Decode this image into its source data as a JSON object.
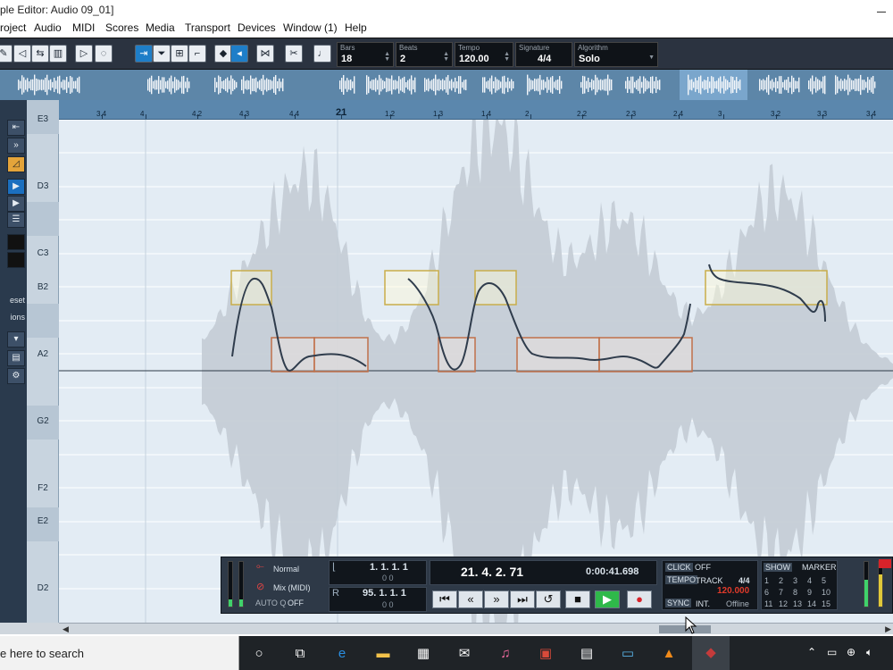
{
  "window": {
    "title": "ple Editor: Audio 09_01]"
  },
  "menu": [
    "roject",
    "Audio",
    "MIDI",
    "Scores",
    "Media",
    "Transport",
    "Devices",
    "Window (1)",
    "Help"
  ],
  "toolbar": {
    "bars_label": "Bars",
    "bars_value": "18",
    "beats_label": "Beats",
    "beats_value": "2",
    "tempo_label": "Tempo",
    "tempo_value": "120.00",
    "signature_label": "Signature",
    "signature_value": "4/4",
    "algorithm_label": "Algorithm",
    "algorithm_value": "Solo"
  },
  "ruler": {
    "ticks": [
      "3.4",
      "4",
      "4.2",
      "4.3",
      "4.4",
      "21",
      "1.2",
      "1.3",
      "1.4",
      "2",
      "2.2",
      "2.3",
      "2.4",
      "3",
      "3.2",
      "3.3",
      "3.4"
    ]
  },
  "pitch_labels": [
    "E3",
    "D3",
    "C3",
    "B2",
    "A2",
    "G2",
    "F2",
    "E2",
    "D2"
  ],
  "left_panel": {
    "preset_label": "eset",
    "options_label": "ions"
  },
  "transport": {
    "mode": "Normal",
    "mix_mode": "Mix (MIDI)",
    "autoq_label": "AUTO Q",
    "autoq_value": "OFF",
    "left_locator": "1. 1. 1.    1",
    "left_sub": "0     0",
    "right_locator": "95. 1. 1.    1",
    "right_sub": "0     0",
    "position_bars": "21. 4. 2. 71",
    "position_time": "0:00:41.698",
    "click_label": "CLICK",
    "click_value": "OFF",
    "tempo_label": "TEMPO",
    "track_label": "TRACK",
    "signature": "4/4",
    "tempo_value": "120.000",
    "sync_label": "SYNC",
    "int_label": "INT.",
    "offline_label": "Offline",
    "show_label": "SHOW",
    "marker_label": "MARKER",
    "markers": [
      "1",
      "2",
      "3",
      "4",
      "5",
      "6",
      "7",
      "8",
      "9",
      "10",
      "11",
      "12",
      "13",
      "14",
      "15"
    ]
  },
  "taskbar": {
    "search_text": "e here to search"
  },
  "colors": {
    "accent_blue": "#1e7ec8",
    "segment_yellow": "#c9ad4a",
    "segment_orange": "#c0704a",
    "play_green": "#2fb94a",
    "record_red": "#d8232a"
  }
}
